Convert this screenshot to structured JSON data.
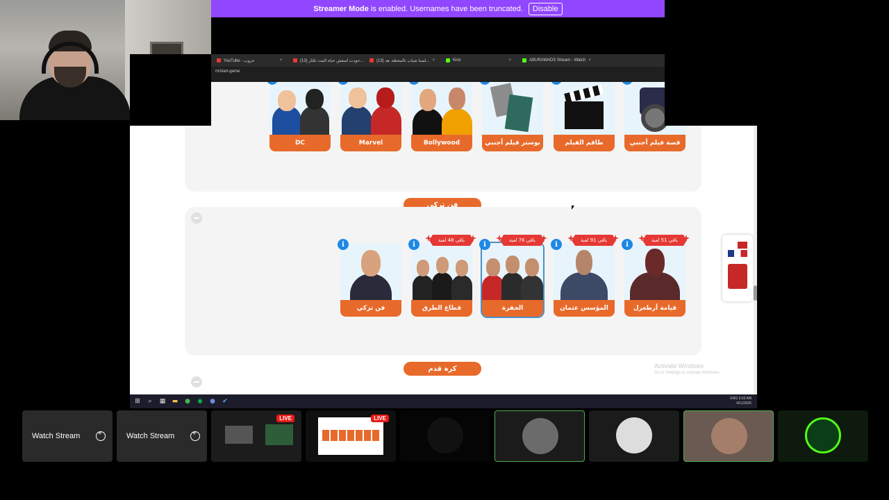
{
  "banner": {
    "strong": "Streamer Mode",
    "message": " is enabled. Usernames have been truncated.",
    "disable_label": "Disable"
  },
  "browser": {
    "tabs": [
      {
        "label": "YouTube - جروب",
        "icon": "youtube-icon"
      },
      {
        "label": "(13) حودت اسعش حياة المدد تكثار...",
        "icon": "youtube-icon"
      },
      {
        "label": "(13) لسنا شباب بالمحطة. هد...",
        "icon": "youtube-icon"
      },
      {
        "label": "Kick",
        "icon": "kick-icon"
      },
      {
        "label": "ABURAWADS Stream - Watch",
        "icon": "kick-icon"
      }
    ],
    "url": "m/start-game"
  },
  "section1": {
    "cards": [
      {
        "label": "DC"
      },
      {
        "label": "Marvel"
      },
      {
        "label": "Bollywood"
      },
      {
        "label": "بوستر فيلم أجنبي"
      },
      {
        "label": "طاقم الفيلم"
      },
      {
        "label": "قصة فيلم أجنبي"
      }
    ]
  },
  "section2": {
    "title": "فن تركي",
    "cards": [
      {
        "label": "فن تركي",
        "ribbon": ""
      },
      {
        "label": "قطاع الطرق",
        "ribbon": "باقي 48 لعبة"
      },
      {
        "label": "الحفرة",
        "ribbon": "باقي 76 لعبة"
      },
      {
        "label": "المؤسس عثمان",
        "ribbon": "باقي 91 لعبة"
      },
      {
        "label": "قيامة أرطغرل",
        "ribbon": "باقي 51 لعبة"
      }
    ]
  },
  "section3": {
    "title": "كرة قدم"
  },
  "watermark": {
    "title": "Activate Windows",
    "sub": "Go to Settings to activate Windows."
  },
  "taskbar": {
    "lang": "ENG",
    "time": "5:03 AM",
    "date": "4/11/2026"
  },
  "tiles": [
    {
      "type": "watch",
      "label": "Watch Stream"
    },
    {
      "type": "watch",
      "label": "Watch Stream"
    },
    {
      "type": "live",
      "badge": "LIVE"
    },
    {
      "type": "live",
      "badge": "LIVE"
    },
    {
      "type": "dark"
    },
    {
      "type": "avatar"
    },
    {
      "type": "avatar"
    },
    {
      "type": "avatar"
    },
    {
      "type": "logo"
    }
  ],
  "colors": {
    "accent_orange": "#e86a2b",
    "streamer_purple": "#9146ff",
    "info_blue": "#1e88e5",
    "ribbon_red": "#e53935"
  }
}
